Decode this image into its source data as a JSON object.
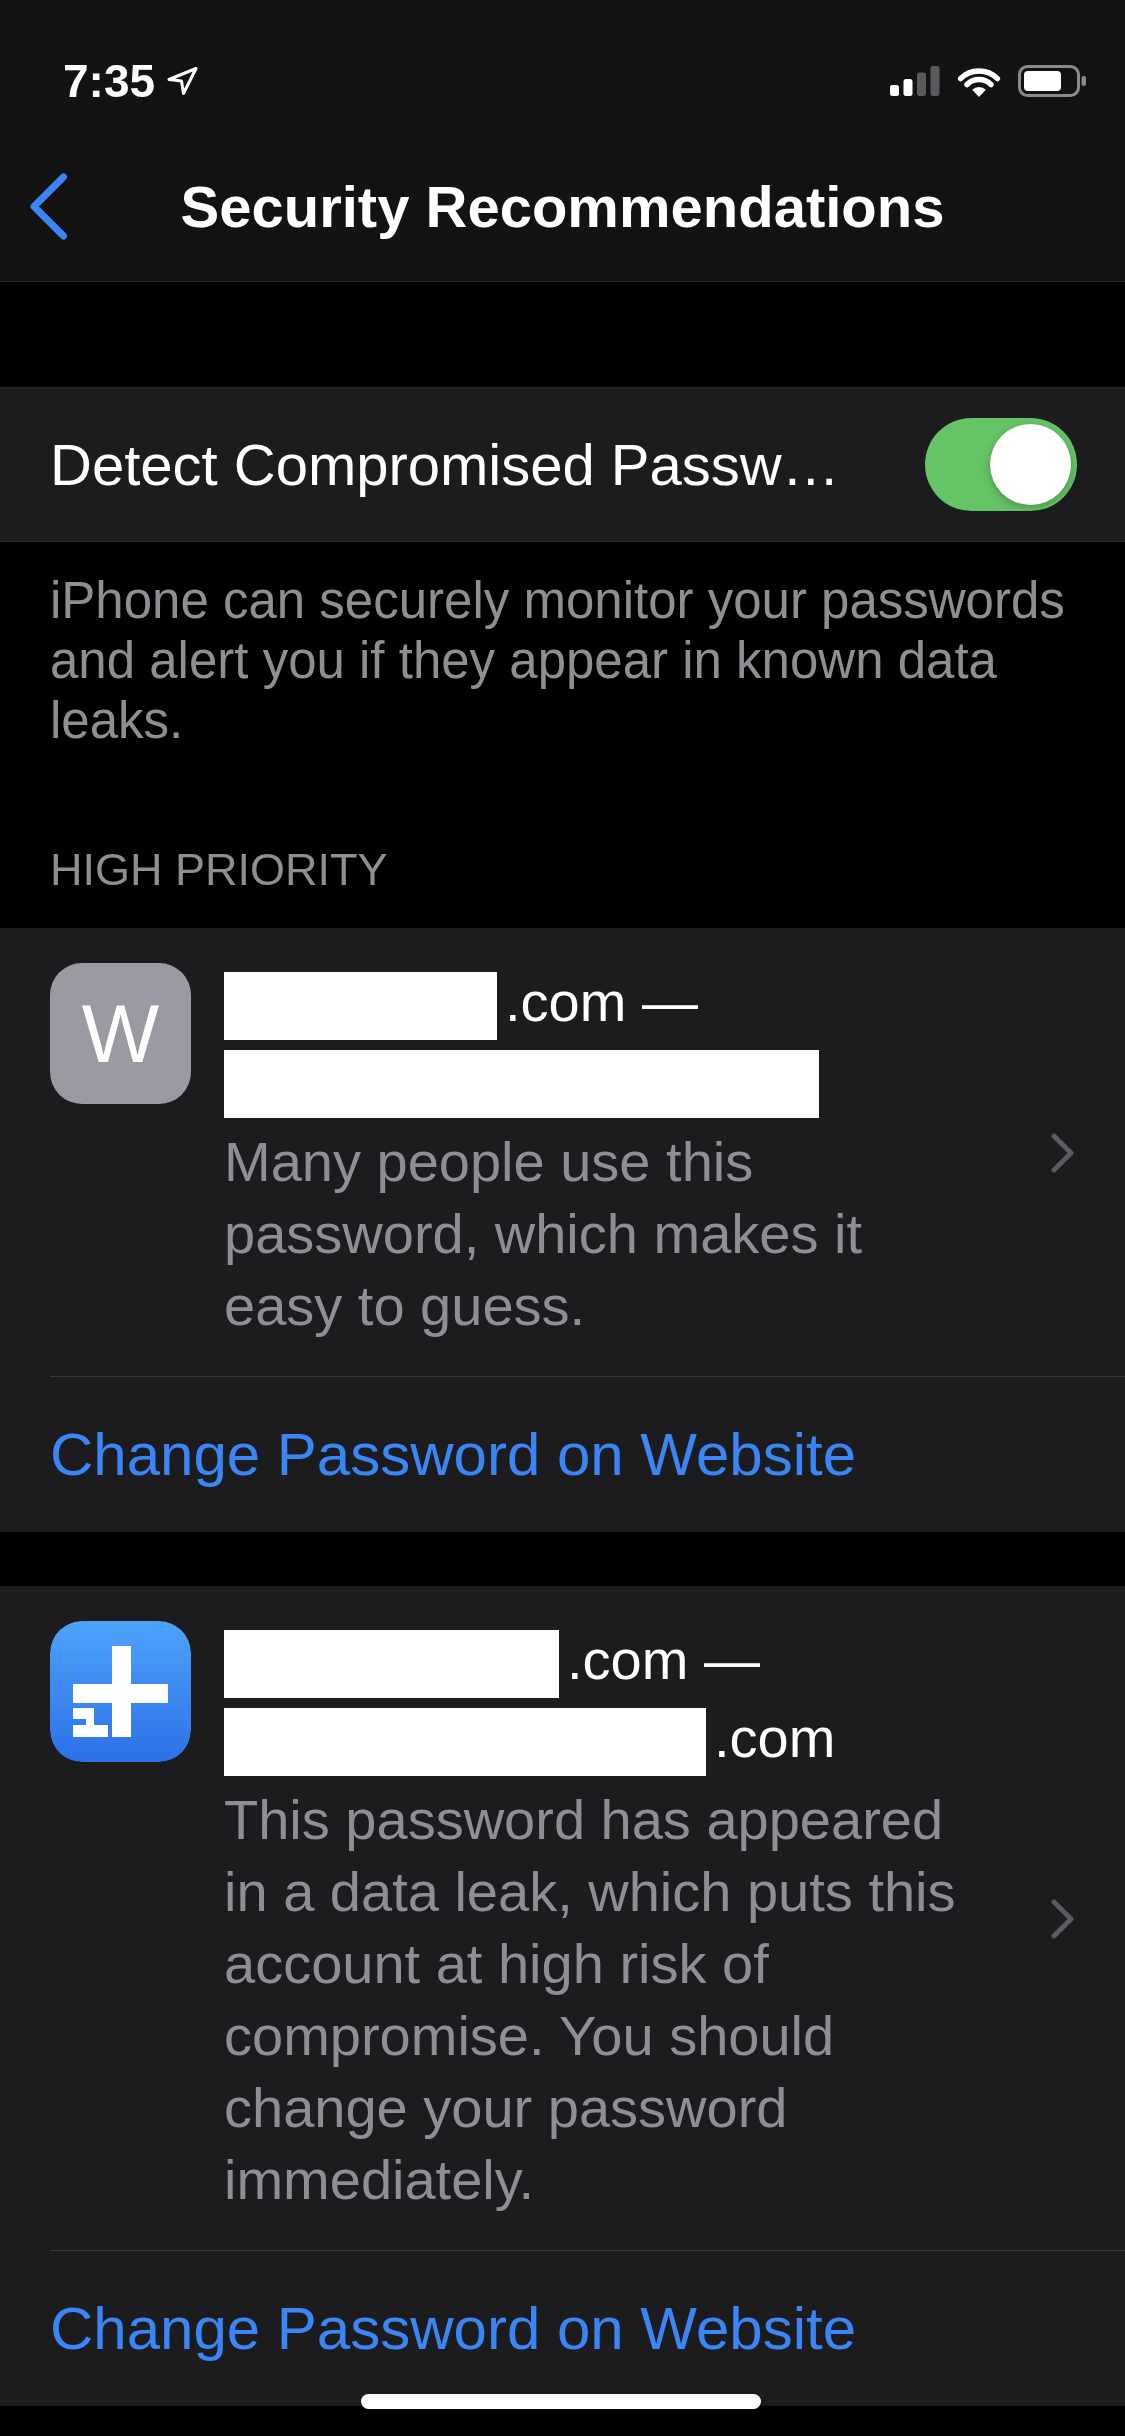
{
  "status_bar": {
    "time": "7:35"
  },
  "nav_bar": {
    "title": "Security Recommendations"
  },
  "detect_setting": {
    "label": "Detect Compromised Passw…",
    "on": true
  },
  "detect_footer": "iPhone can securely monitor your passwords and alert you if they appear in known data leaks.",
  "section_header": "HIGH PRIORITY",
  "recommendations": [
    {
      "icon": {
        "kind": "letter",
        "letter": "W"
      },
      "title_lines": [
        [
          {
            "kind": "redacted"
          },
          {
            "kind": "text",
            "text": ".com —"
          }
        ],
        [
          {
            "kind": "redacted"
          }
        ]
      ],
      "description": "Many people use this password, which makes it easy to guess.",
      "action": "Change Password on Website"
    },
    {
      "icon": {
        "kind": "app"
      },
      "title_lines": [
        [
          {
            "kind": "redacted"
          },
          {
            "kind": "text",
            "text": ".com —"
          }
        ],
        [
          {
            "kind": "redacted"
          },
          {
            "kind": "text",
            "text": ".com"
          }
        ]
      ],
      "description": "This password has appeared in a data leak, which puts this account at high risk of compromise. You should change your password immediately.",
      "action": "Change Password on Website"
    }
  ]
}
